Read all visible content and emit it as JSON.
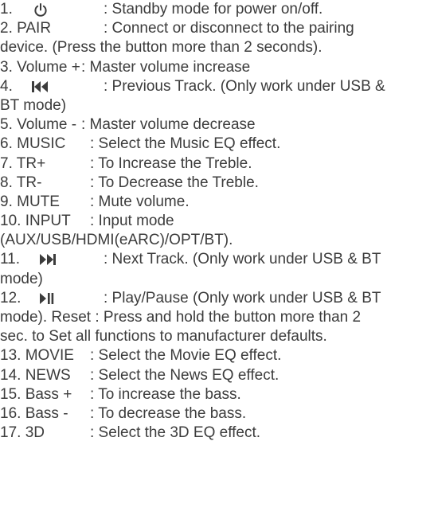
{
  "items": [
    {
      "num": "1.",
      "label": "",
      "icon": "power-icon",
      "desc": ": Standby mode for power on/off."
    },
    {
      "num": "2. PAIR",
      "label": "",
      "desc": ": Connect or disconnect to the pairing",
      "cont": "device. (Press the button more than 2 seconds)."
    },
    {
      "num": "3. Volume +",
      "desc": ": Master volume increase"
    },
    {
      "num": "4.",
      "icon": "previous-track-icon",
      "desc": ": Previous Track. (Only work under USB &",
      "cont": "BT mode)"
    },
    {
      "num": "5. Volume -",
      "desc": ": Master volume decrease"
    },
    {
      "num": "6. MUSIC",
      "desc": ": Select the Music EQ effect."
    },
    {
      "num": "7. TR+",
      "desc": ": To Increase the Treble."
    },
    {
      "num": "8. TR-",
      "desc": ": To Decrease the Treble."
    },
    {
      "num": "9. MUTE",
      "desc": ": Mute volume."
    },
    {
      "num": "10. INPUT",
      "desc": ": Input mode",
      "cont": "(AUX/USB/HDMI(eARC)/OPT/BT)."
    },
    {
      "num": "11.",
      "icon": "next-track-icon",
      "desc": ": Next Track. (Only work under USB & BT",
      "cont": "mode)"
    },
    {
      "num": "12.",
      "icon": "play-pause-icon",
      "desc": ": Play/Pause (Only work under USB & BT",
      "cont": "mode). Reset : Press and hold the button more than 2",
      "cont2": "sec. to Set all functions to manufacturer defaults."
    },
    {
      "num": "13. MOVIE",
      "desc": ": Select the Movie EQ effect."
    },
    {
      "num": "14. NEWS",
      "desc": ": Select the News EQ effect."
    },
    {
      "num": "15. Bass +",
      "desc": ": To increase the bass."
    },
    {
      "num": "16. Bass -",
      "desc": ": To decrease the bass."
    },
    {
      "num": "17. 3D",
      "desc": ": Select the 3D EQ effect."
    }
  ]
}
